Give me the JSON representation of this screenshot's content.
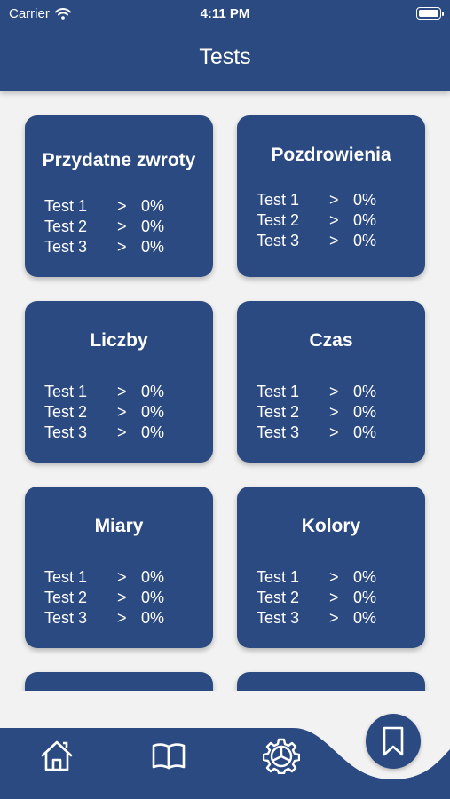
{
  "status_bar": {
    "carrier": "Carrier",
    "time": "4:11 PM"
  },
  "header": {
    "title": "Tests"
  },
  "categories": [
    {
      "title": "Przydatne zwroty",
      "tests": [
        {
          "name": "Test 1",
          "arrow": ">",
          "score": "0%"
        },
        {
          "name": "Test 2",
          "arrow": ">",
          "score": "0%"
        },
        {
          "name": "Test 3",
          "arrow": ">",
          "score": "0%"
        }
      ]
    },
    {
      "title": "Pozdrowienia",
      "tests": [
        {
          "name": "Test 1",
          "arrow": ">",
          "score": "0%"
        },
        {
          "name": "Test 2",
          "arrow": ">",
          "score": "0%"
        },
        {
          "name": "Test 3",
          "arrow": ">",
          "score": "0%"
        }
      ]
    },
    {
      "title": "Liczby",
      "tests": [
        {
          "name": "Test 1",
          "arrow": ">",
          "score": "0%"
        },
        {
          "name": "Test 2",
          "arrow": ">",
          "score": "0%"
        },
        {
          "name": "Test 3",
          "arrow": ">",
          "score": "0%"
        }
      ]
    },
    {
      "title": "Czas",
      "tests": [
        {
          "name": "Test 1",
          "arrow": ">",
          "score": "0%"
        },
        {
          "name": "Test 2",
          "arrow": ">",
          "score": "0%"
        },
        {
          "name": "Test 3",
          "arrow": ">",
          "score": "0%"
        }
      ]
    },
    {
      "title": "Miary",
      "tests": [
        {
          "name": "Test 1",
          "arrow": ">",
          "score": "0%"
        },
        {
          "name": "Test 2",
          "arrow": ">",
          "score": "0%"
        },
        {
          "name": "Test 3",
          "arrow": ">",
          "score": "0%"
        }
      ]
    },
    {
      "title": "Kolory",
      "tests": [
        {
          "name": "Test 1",
          "arrow": ">",
          "score": "0%"
        },
        {
          "name": "Test 2",
          "arrow": ">",
          "score": "0%"
        },
        {
          "name": "Test 3",
          "arrow": ">",
          "score": "0%"
        }
      ]
    }
  ],
  "tab_bar": {
    "items": [
      {
        "icon": "home-icon"
      },
      {
        "icon": "book-icon"
      },
      {
        "icon": "gear-icon"
      },
      {
        "icon": "bookmark-icon",
        "active": true
      }
    ]
  },
  "colors": {
    "primary": "#2b4a82",
    "background": "#f2f2f2",
    "text_on_primary": "#ffffff"
  }
}
